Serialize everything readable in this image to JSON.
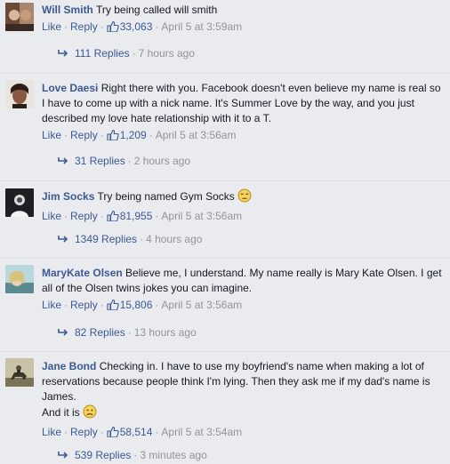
{
  "actions": {
    "like": "Like",
    "reply": "Reply",
    "sep": "·"
  },
  "comments": [
    {
      "author": "Will Smith",
      "text": "Try being called will smith",
      "likes": "33,063",
      "date": "April 5 at 3:59am",
      "replies": "111 Replies",
      "reply_time": "7 hours ago"
    },
    {
      "author": "Love Daesi",
      "text": "Right there with you. Facebook doesn't even believe my name is real so I have to come up with a nick name. It's Summer Love by the way, and you just described my love hate relationship with it to a T.",
      "likes": "1,209",
      "date": "April 5 at 3:56am",
      "replies": "31 Replies",
      "reply_time": "2 hours ago"
    },
    {
      "author": "Jim Socks",
      "text": "Try being named Gym Socks",
      "emoji": "unamused-face-icon",
      "likes": "81,955",
      "date": "April 5 at 3:56am",
      "replies": "1349 Replies",
      "reply_time": "4 hours ago"
    },
    {
      "author": "MaryKate Olsen",
      "text": "Believe me, I understand. My name really is Mary Kate Olsen. I get all of the Olsen twins jokes you can imagine.",
      "likes": "15,806",
      "date": "April 5 at 3:56am",
      "replies": "82 Replies",
      "reply_time": "13 hours ago"
    },
    {
      "author": "Jane Bond",
      "text": "Checking in. I have to use my boyfriend's name when making a lot of reservations because people think I'm lying. Then they ask me if my dad's name is James.",
      "text2": "And it is",
      "emoji": "sad-face-icon",
      "likes": "58,514",
      "date": "April 5 at 3:54am",
      "replies": "539 Replies",
      "reply_time": "3 minutes ago"
    }
  ],
  "colors": {
    "link": "#3b5998",
    "meta": "#90949c",
    "background": "#e9ebee"
  }
}
